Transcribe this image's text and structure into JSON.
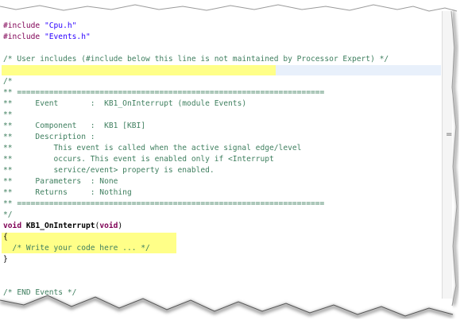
{
  "editor": {
    "lines": [
      {
        "parts": [
          {
            "cls": "c-pp",
            "t": "#include "
          },
          {
            "cls": "c-str",
            "t": "\"Cpu.h\""
          }
        ]
      },
      {
        "parts": [
          {
            "cls": "c-pp",
            "t": "#include "
          },
          {
            "cls": "c-str",
            "t": "\"Events.h\""
          }
        ]
      },
      {
        "parts": []
      },
      {
        "parts": [
          {
            "cls": "c-com",
            "t": "/* User includes (#include below this line is not maintained by Processor Expert) */"
          }
        ]
      },
      {
        "parts": []
      },
      {
        "parts": [
          {
            "cls": "c-com",
            "t": "/*"
          }
        ]
      },
      {
        "parts": [
          {
            "cls": "c-com",
            "t": "** ==================================================================="
          }
        ]
      },
      {
        "parts": [
          {
            "cls": "c-com",
            "t": "**     Event       :  KB1_OnInterrupt (module Events)"
          }
        ]
      },
      {
        "parts": [
          {
            "cls": "c-com",
            "t": "**"
          }
        ]
      },
      {
        "parts": [
          {
            "cls": "c-com",
            "t": "**     Component   :  KB1 [KBI]"
          }
        ]
      },
      {
        "parts": [
          {
            "cls": "c-com",
            "t": "**     Description :"
          }
        ]
      },
      {
        "parts": [
          {
            "cls": "c-com",
            "t": "**         This event is called when the active signal edge/level"
          }
        ]
      },
      {
        "parts": [
          {
            "cls": "c-com",
            "t": "**         occurs. This event is enabled only if <Interrupt"
          }
        ]
      },
      {
        "parts": [
          {
            "cls": "c-com",
            "t": "**         service/event> property is enabled."
          }
        ]
      },
      {
        "parts": [
          {
            "cls": "c-com",
            "t": "**     Parameters  : None"
          }
        ]
      },
      {
        "parts": [
          {
            "cls": "c-com",
            "t": "**     Returns     : Nothing"
          }
        ]
      },
      {
        "parts": [
          {
            "cls": "c-com",
            "t": "** ==================================================================="
          }
        ]
      },
      {
        "parts": [
          {
            "cls": "c-com",
            "t": "*/"
          }
        ]
      },
      {
        "parts": [
          {
            "cls": "c-kw",
            "t": "void "
          },
          {
            "cls": "c-fn",
            "t": "KB1_OnInterrupt"
          },
          {
            "cls": "c-txt",
            "t": "("
          },
          {
            "cls": "c-kw",
            "t": "void"
          },
          {
            "cls": "c-txt",
            "t": ")"
          }
        ]
      },
      {
        "parts": [
          {
            "cls": "c-txt",
            "t": "{"
          }
        ]
      },
      {
        "parts": [
          {
            "cls": "c-com",
            "t": "  /* Write your code here ... */"
          }
        ]
      },
      {
        "parts": [
          {
            "cls": "c-txt",
            "t": "}"
          }
        ]
      },
      {
        "parts": []
      },
      {
        "parts": []
      },
      {
        "parts": [
          {
            "cls": "c-com",
            "t": "/* END Events */"
          }
        ]
      }
    ]
  },
  "scrollbar": {
    "marker": "="
  }
}
